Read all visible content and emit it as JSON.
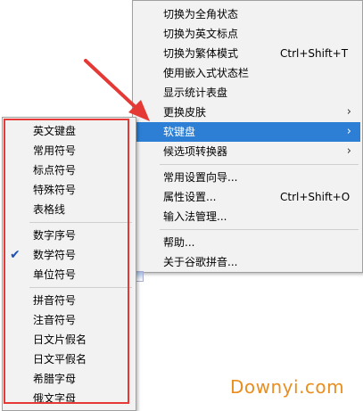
{
  "main_menu": {
    "items": [
      {
        "label": "切换为全角状态",
        "shortcut": "",
        "submenu": false
      },
      {
        "label": "切换为英文标点",
        "shortcut": "",
        "submenu": false
      },
      {
        "label": "切换为繁体模式",
        "shortcut": "Ctrl+Shift+T",
        "submenu": false
      },
      {
        "label": "使用嵌入式状态栏",
        "shortcut": "",
        "submenu": false
      },
      {
        "label": "显示统计表盘",
        "shortcut": "",
        "submenu": false
      },
      {
        "label": "更换皮肤",
        "shortcut": "",
        "submenu": true
      },
      {
        "label": "软键盘",
        "shortcut": "",
        "submenu": true,
        "highlighted": true
      },
      {
        "label": "候选项转换器",
        "shortcut": "",
        "submenu": true
      },
      {
        "label": "常用设置向导...",
        "shortcut": "",
        "submenu": false
      },
      {
        "label": "属性设置...",
        "shortcut": "Ctrl+Shift+O",
        "submenu": false
      },
      {
        "label": "输入法管理...",
        "shortcut": "",
        "submenu": false
      },
      {
        "label": "帮助...",
        "shortcut": "",
        "submenu": false
      },
      {
        "label": "关于谷歌拼音...",
        "shortcut": "",
        "submenu": false
      }
    ],
    "arrow_glyph": "›"
  },
  "sub_menu": {
    "items": [
      {
        "label": "英文键盘",
        "checked": false
      },
      {
        "label": "常用符号",
        "checked": false
      },
      {
        "label": "标点符号",
        "checked": false
      },
      {
        "label": "特殊符号",
        "checked": false
      },
      {
        "label": "表格线",
        "checked": false
      },
      {
        "label": "数字序号",
        "checked": false
      },
      {
        "label": "数学符号",
        "checked": true
      },
      {
        "label": "单位符号",
        "checked": false
      },
      {
        "label": "拼音符号",
        "checked": false
      },
      {
        "label": "注音符号",
        "checked": false
      },
      {
        "label": "日文片假名",
        "checked": false
      },
      {
        "label": "日文平假名",
        "checked": false
      },
      {
        "label": "希腊字母",
        "checked": false
      },
      {
        "label": "俄文字母",
        "checked": false
      }
    ],
    "check_glyph": "✔"
  },
  "watermark": "Downyi.com",
  "colors": {
    "highlight": "#2c7fd4",
    "annotation_red": "#e53935",
    "watermark_orange": "#e98e20"
  }
}
